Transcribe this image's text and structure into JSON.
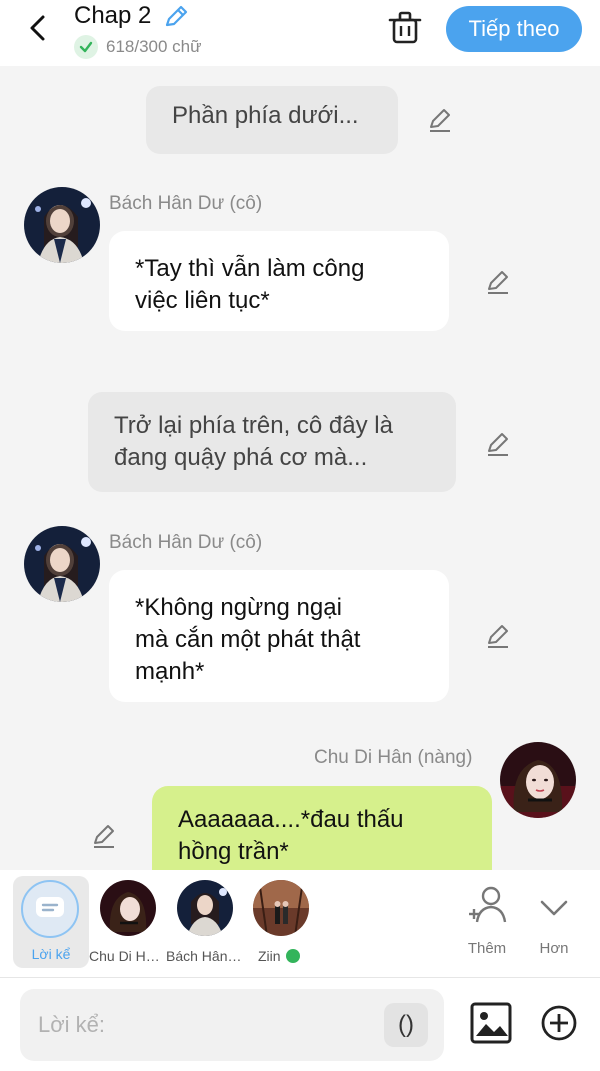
{
  "header": {
    "title": "Chap 2",
    "word_count": "618/300 chữ",
    "next_label": "Tiếp theo"
  },
  "colors": {
    "accent": "#4ba3ee",
    "right_bubble": "#d6f08c",
    "narration_bg": "#e8e8e8",
    "ok_green": "#33b45b"
  },
  "messages": [
    {
      "type": "narration",
      "text": "Phần phía dưới..."
    },
    {
      "type": "speech-left",
      "speaker": "Bách Hân Dư (cô)",
      "lines": [
        "*Tay thì vẫn làm công",
        "việc liên tục*"
      ]
    },
    {
      "type": "narration",
      "lines": [
        "Trở lại phía trên, cô đây là",
        "đang quậy phá cơ mà..."
      ]
    },
    {
      "type": "speech-left",
      "speaker": "Bách Hân Dư (cô)",
      "lines": [
        "*Không ngừng ngại",
        "mà cắn một phát thật",
        "mạnh*"
      ]
    },
    {
      "type": "speech-right",
      "speaker": "Chu Di Hân (nàng)",
      "lines": [
        "Aaaaaaa....*đau thấu",
        "hồng trần*"
      ]
    }
  ],
  "characters": [
    {
      "label": "Lời kể",
      "icon": "chat-bubble-icon"
    },
    {
      "label": "Chu Di Hân (nàng)"
    },
    {
      "label": "Bách Hân Dư (cô)"
    },
    {
      "label": "Ziin"
    }
  ],
  "side_actions": {
    "add_label": "Thêm",
    "more_label": "Hơn"
  },
  "input": {
    "placeholder": "Lời kể:",
    "paren_label": "()"
  }
}
